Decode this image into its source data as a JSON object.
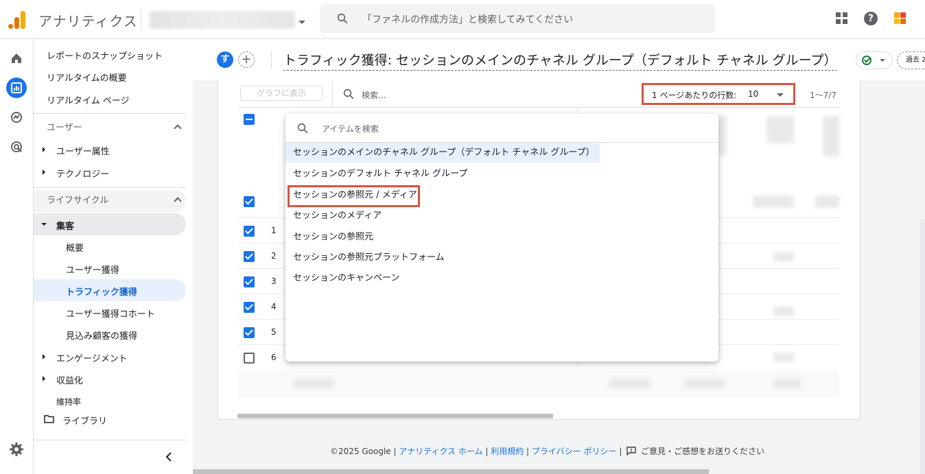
{
  "header": {
    "app_title": "アナリティクス",
    "search_placeholder": "「ファネルの作成方法」と検索してみてください"
  },
  "nav": {
    "top_items": [
      "レポートのスナップショット",
      "リアルタイムの概要",
      "リアルタイム ページ"
    ],
    "user_section": "ユーザー",
    "user_items": [
      "ユーザー属性",
      "テクノロジー"
    ],
    "lifecycle_section": "ライフサイクル",
    "acquisition": "集客",
    "acquisition_items": [
      "概要",
      "ユーザー獲得",
      "トラフィック獲得",
      "ユーザー獲得コホート",
      "見込み顧客の獲得"
    ],
    "lifecycle_items": [
      "エンゲージメント",
      "収益化",
      "維持率"
    ],
    "library": "ライブラリ"
  },
  "report": {
    "avatar_letter": "す",
    "add_label": "+",
    "title": "トラフィック獲得: セッションのメインのチャネル グループ（デフォルト チャネル グループ）",
    "date_label": "過去 2"
  },
  "toolbar": {
    "graph_button": "グラフに表示",
    "search_placeholder": "検索...",
    "rows_label": "1 ページあたりの行数:",
    "rows_value": "10",
    "range": "1〜7/7"
  },
  "table": {
    "rows": [
      {
        "num": "1",
        "checked": true
      },
      {
        "num": "2",
        "checked": true
      },
      {
        "num": "3",
        "checked": true
      },
      {
        "num": "4",
        "checked": true
      },
      {
        "num": "5",
        "checked": true
      },
      {
        "num": "6",
        "checked": false
      }
    ]
  },
  "dropdown": {
    "search_placeholder": "アイテムを検索",
    "options": [
      "セッションのメインのチャネル グループ（デフォルト チャネル グループ）",
      "セッションのデフォルト チャネル グループ",
      "セッションの参照元 / メディア",
      "セッションのメディア",
      "セッションの参照元",
      "セッションの参照元プラットフォーム",
      "セッションのキャンペーン"
    ]
  },
  "footer": {
    "copyright": "©2025 Google |",
    "home": "アナリティクス ホーム",
    "sep1": "|",
    "terms": "利用規約",
    "sep2": "|",
    "privacy": "プライバシー ポリシー",
    "sep3": "|",
    "feedback": "ご意見・ご感想をお送りください"
  },
  "colors": {
    "accent": "#1a73e8",
    "highlight_box": "#d9533f"
  }
}
